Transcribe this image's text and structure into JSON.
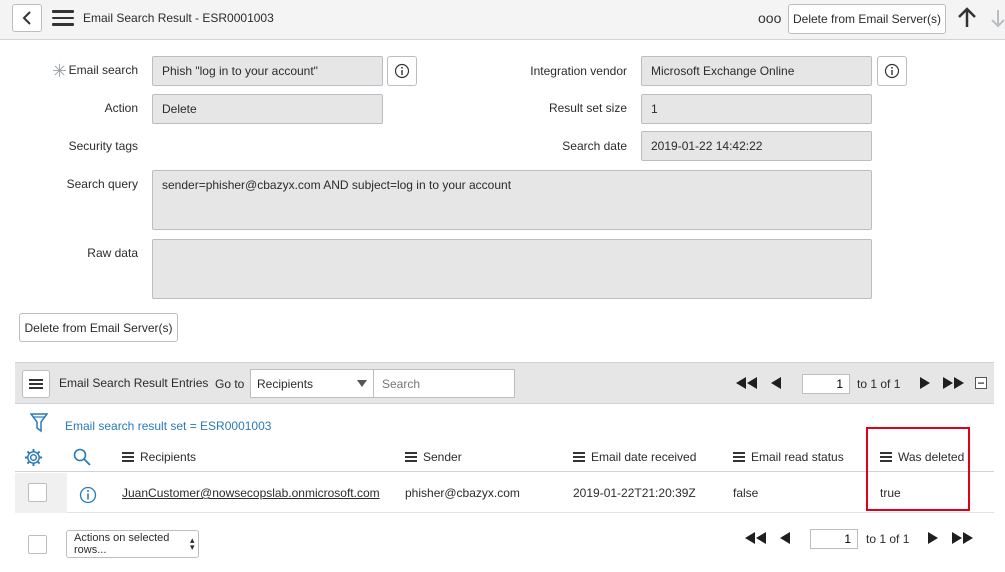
{
  "header": {
    "title": "Email Search Result - ESR0001003",
    "more_label": "ooo",
    "delete_button": "Delete from Email Server(s)"
  },
  "form": {
    "email_search_label": "Email search",
    "email_search_value": "Phish \"log in to your account\"",
    "action_label": "Action",
    "action_value": "Delete",
    "security_tags_label": "Security tags",
    "search_query_label": "Search query",
    "search_query_value": "sender=phisher@cbazyx.com AND subject=log in to your account",
    "raw_data_label": "Raw data",
    "raw_data_value": "",
    "integration_vendor_label": "Integration vendor",
    "integration_vendor_value": "Microsoft Exchange Online",
    "result_set_size_label": "Result set size",
    "result_set_size_value": "1",
    "search_date_label": "Search date",
    "search_date_value": "2019-01-22 14:42:22",
    "delete_button": "Delete from Email Server(s)"
  },
  "related_list": {
    "title": "Email Search Result Entries",
    "goto_label": "Go to",
    "goto_select": "Recipients",
    "search_placeholder": "Search",
    "page_value": "1",
    "page_total": "to 1 of 1",
    "filter_text": "Email search result set = ESR0001003",
    "columns": [
      "Recipients",
      "Sender",
      "Email date received",
      "Email read status",
      "Was deleted"
    ],
    "rows": [
      {
        "recipient": "JuanCustomer@nowsecopslab.onmicrosoft.com",
        "sender": "phisher@cbazyx.com",
        "date": "2019-01-22T21:20:39Z",
        "read_status": "false",
        "was_deleted": "true"
      }
    ],
    "actions_select": "Actions on selected rows...",
    "bottom_page_value": "1",
    "bottom_page_total": "to 1 of 1"
  },
  "colors": {
    "accent_link": "#2a7ab8",
    "highlight": "#e0001b",
    "field_bg": "#e6e6e6"
  }
}
